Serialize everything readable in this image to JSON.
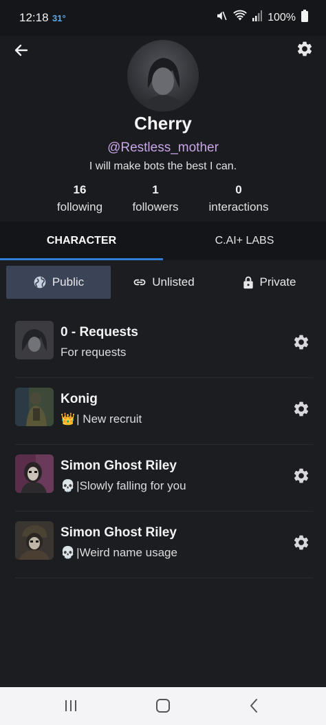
{
  "status_bar": {
    "time": "12:18",
    "temperature": "31°",
    "battery": "100%",
    "icons": [
      "mute-icon",
      "wifi-icon",
      "signal-icon",
      "battery-icon"
    ]
  },
  "profile": {
    "name": "Cherry",
    "handle": "@Restless_mother",
    "bio": "I will make bots the best I can.",
    "stats": [
      {
        "value": "16",
        "label": "following"
      },
      {
        "value": "1",
        "label": "followers"
      },
      {
        "value": "0",
        "label": "interactions"
      }
    ]
  },
  "tabs": [
    {
      "label": "CHARACTER",
      "active": true
    },
    {
      "label": "C.AI+ LABS",
      "active": false
    }
  ],
  "filters": [
    {
      "label": "Public",
      "icon": "globe-icon",
      "active": true
    },
    {
      "label": "Unlisted",
      "icon": "link-icon",
      "active": false
    },
    {
      "label": "Private",
      "icon": "lock-icon",
      "active": false
    }
  ],
  "characters": [
    {
      "title": "0 - Requests",
      "emoji": "",
      "subtitle": "For requests"
    },
    {
      "title": "Konig",
      "emoji": "👑",
      "subtitle": "| New recruit"
    },
    {
      "title": "Simon Ghost Riley",
      "emoji": "💀",
      "subtitle": "|Slowly falling for you"
    },
    {
      "title": "Simon Ghost Riley",
      "emoji": "💀",
      "subtitle": "|Weird name usage"
    }
  ],
  "colors": {
    "background": "#1c1d20",
    "accent_tab": "#2f7fd8",
    "handle": "#c9a6e8",
    "active_filter": "#3b4456"
  }
}
